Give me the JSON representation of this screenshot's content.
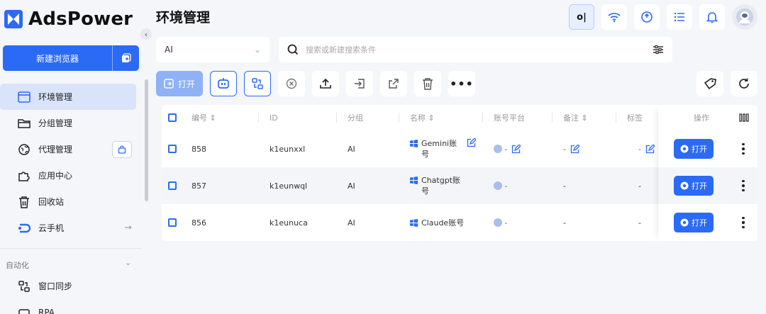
{
  "brand": {
    "name": "AdsPower",
    "accent": "#2b6af5"
  },
  "sidebar": {
    "new_browser_label": "新建浏览器",
    "items": [
      {
        "label": "环境管理",
        "icon": "browser-window-icon",
        "active": true
      },
      {
        "label": "分组管理",
        "icon": "folder-icon"
      },
      {
        "label": "代理管理",
        "icon": "proxy-icon"
      },
      {
        "label": "应用中心",
        "icon": "puzzle-icon"
      },
      {
        "label": "回收站",
        "icon": "trash-icon"
      },
      {
        "label": "云手机",
        "icon": "cloud-phone-icon"
      }
    ],
    "automation_section": "自动化",
    "automation_items": [
      {
        "label": "窗口同步",
        "icon": "window-sync-icon"
      },
      {
        "label": "RPA",
        "icon": "rpa-icon"
      }
    ]
  },
  "header": {
    "title": "环境管理",
    "ol_badge": "o|"
  },
  "filters": {
    "group_value": "AI",
    "search_placeholder": "搜索或新建搜索条件"
  },
  "toolbar": {
    "open_label": "打开"
  },
  "table": {
    "columns": {
      "number": "编号",
      "id": "ID",
      "group": "分组",
      "name": "名称",
      "platform": "账号平台",
      "notes": "备注",
      "tags": "标签",
      "actions": "操作"
    },
    "rows": [
      {
        "number": "858",
        "id": "k1eunxxl",
        "group": "AI",
        "name": "Gemini账号",
        "platform": "-",
        "notes": "-",
        "tags": "-",
        "open": "打开"
      },
      {
        "number": "857",
        "id": "k1eunwql",
        "group": "AI",
        "name": "Chatgpt账号",
        "platform": "-",
        "notes": "-",
        "tags": "-",
        "open": "打开"
      },
      {
        "number": "856",
        "id": "k1eunuca",
        "group": "AI",
        "name": "Claude账号",
        "platform": "-",
        "notes": "-",
        "tags": "-",
        "open": "打开"
      }
    ]
  }
}
